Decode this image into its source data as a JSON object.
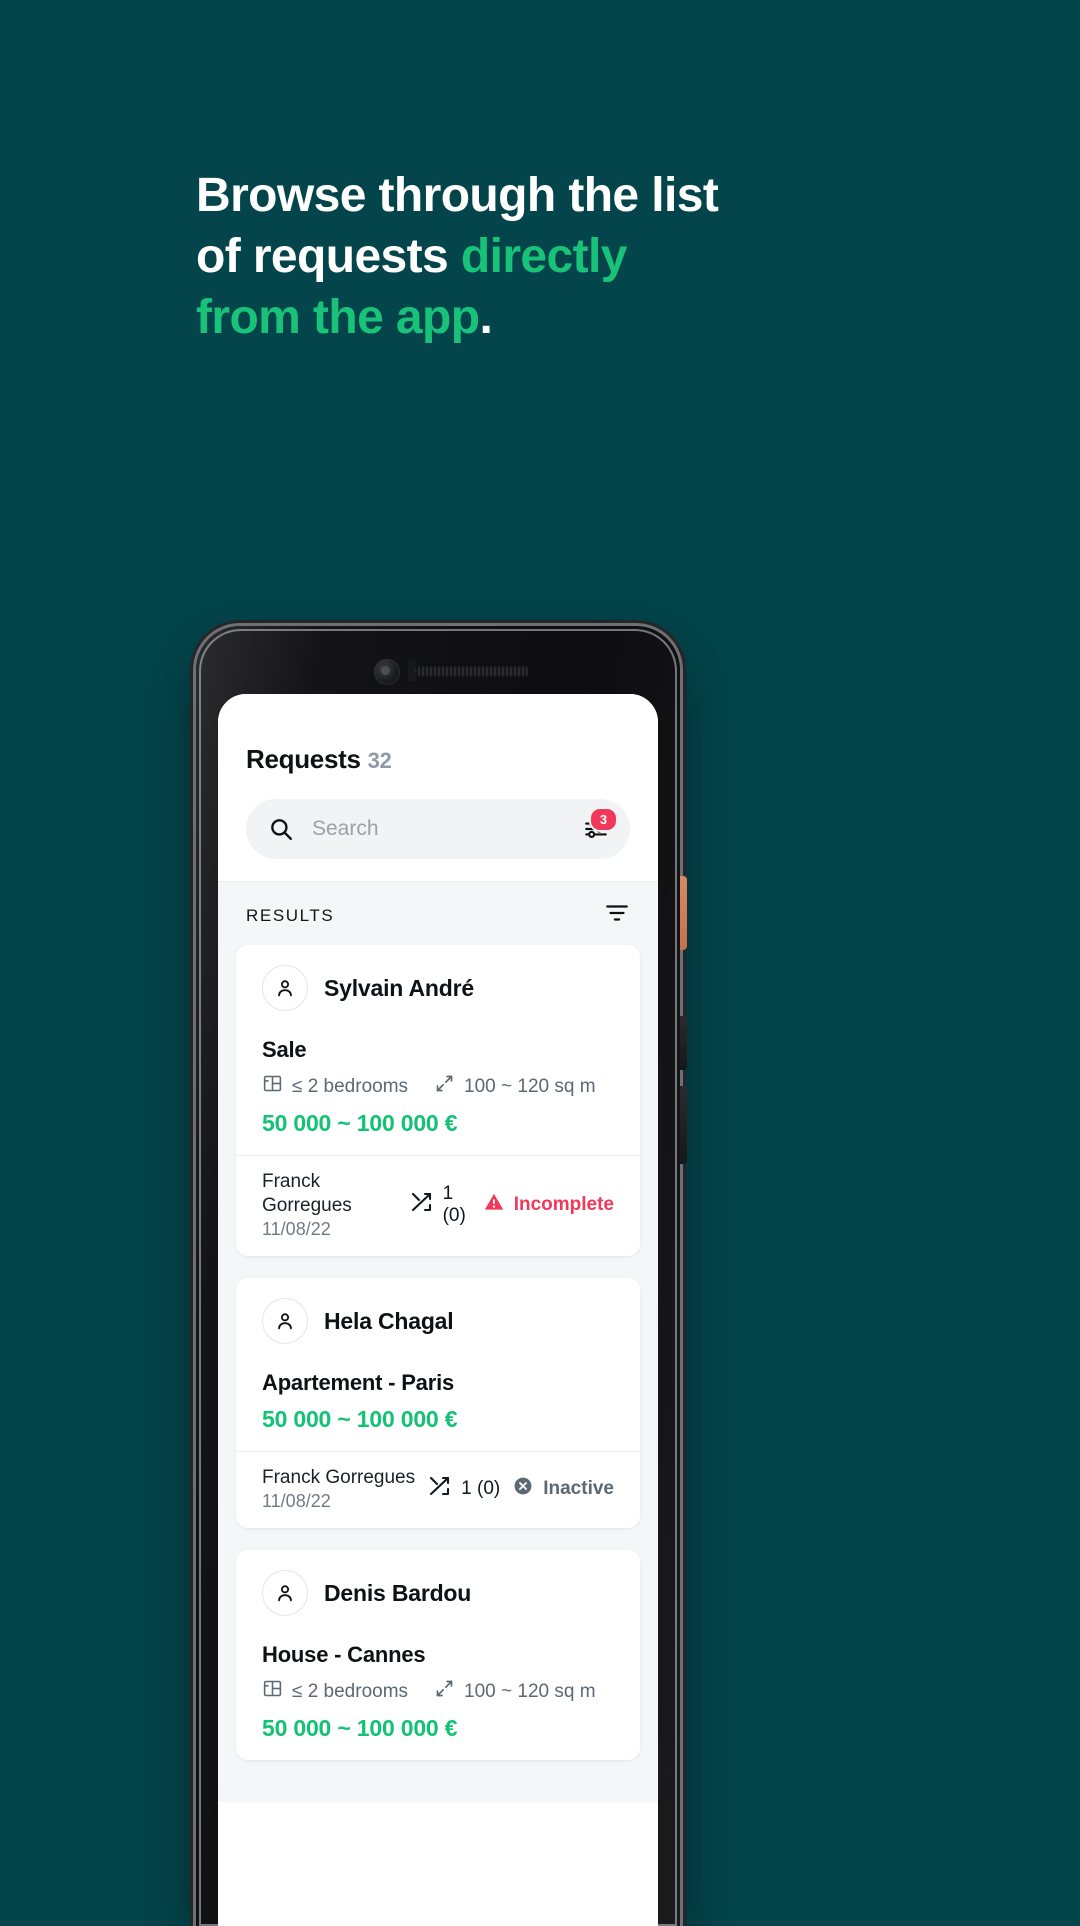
{
  "colors": {
    "background": "#03454b",
    "accent_green": "#18c278",
    "price_green": "#12c275",
    "danger_red": "#f2385a",
    "muted": "#6f7b85"
  },
  "headline": {
    "line1": "Browse through the list",
    "line2_plain": "of requests ",
    "line2_highlight": "directly",
    "line3_highlight": "from the app",
    "line3_period": "."
  },
  "app": {
    "title": "Requests",
    "count": "32",
    "search": {
      "placeholder": "Search",
      "icon": "search-icon",
      "filter_icon": "sliders-icon",
      "filter_badge": "3"
    },
    "results_label": "RESULTS",
    "sort_icon": "filter-lines-icon",
    "cards": [
      {
        "name": "Sylvain André",
        "property": "Sale",
        "specs": [
          {
            "icon": "floorplan-icon",
            "text": "≤ 2 bedrooms"
          },
          {
            "icon": "expand-icon",
            "text": "100 ~ 120 sq m"
          }
        ],
        "price": "50 000 ~ 100 000 €",
        "agent": "Franck Gorregues",
        "date": "11/08/22",
        "matches": "1 (0)",
        "matches_icon": "shuffle-icon",
        "status": "Incomplete",
        "status_type": "incomplete",
        "status_icon": "warning-triangle-icon"
      },
      {
        "name": "Hela Chagal",
        "property": "Apartement - Paris",
        "specs": [],
        "price": "50 000 ~ 100 000 €",
        "agent": "Franck Gorregues",
        "date": "11/08/22",
        "matches": "1 (0)",
        "matches_icon": "shuffle-icon",
        "status": "Inactive",
        "status_type": "inactive",
        "status_icon": "close-circle-icon"
      },
      {
        "name": "Denis Bardou",
        "property": "House - Cannes",
        "specs": [
          {
            "icon": "floorplan-icon",
            "text": "≤ 2 bedrooms"
          },
          {
            "icon": "expand-icon",
            "text": "100 ~ 120 sq m"
          }
        ],
        "price": "50 000 ~ 100 000 €",
        "agent": "",
        "date": "",
        "matches": "",
        "matches_icon": "shuffle-icon",
        "status": "",
        "status_type": "none",
        "status_icon": ""
      }
    ]
  }
}
